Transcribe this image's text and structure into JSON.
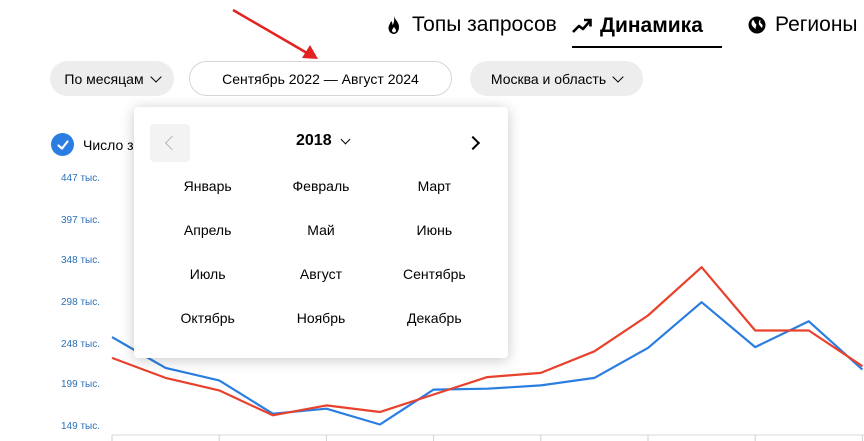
{
  "tabs": [
    {
      "label": "Топы запросов",
      "icon": "fire-icon",
      "active": false
    },
    {
      "label": "Динамика",
      "icon": "trend-up-icon",
      "active": true
    },
    {
      "label": "Регионы",
      "icon": "globe-icon",
      "active": false
    }
  ],
  "filters": {
    "period_mode": "По месяцам",
    "date_range": "Сентябрь 2022 — Август 2024",
    "region": "Москва и область"
  },
  "legend": {
    "series_label": "Число за"
  },
  "picker": {
    "year": "2018",
    "months": [
      "Январь",
      "Февраль",
      "Март",
      "Апрель",
      "Май",
      "Июнь",
      "Июль",
      "Август",
      "Сентябрь",
      "Октябрь",
      "Ноябрь",
      "Декабрь"
    ]
  },
  "colors": {
    "accent": "#2a7de1",
    "series_blue": "#2a7de1",
    "series_red": "#e8412c",
    "annotation_arrow": "#e32222"
  },
  "chart_data": {
    "type": "line",
    "y_tick_labels": [
      "447 тыс.",
      "397 тыс.",
      "348 тыс.",
      "298 тыс.",
      "248 тыс.",
      "199 тыс.",
      "149 тыс."
    ],
    "y_ticks": [
      447,
      397,
      348,
      298,
      248,
      199,
      149
    ],
    "ylim": [
      149,
      447
    ],
    "grid": false,
    "series": [
      {
        "color": "#2a7de1",
        "values": [
          257,
          220,
          205,
          165,
          171,
          152,
          194,
          195,
          199,
          208,
          244,
          299,
          245,
          276,
          218
        ]
      },
      {
        "color": "#e8412c",
        "values": [
          232,
          208,
          193,
          163,
          175,
          167,
          188,
          209,
          214,
          240,
          283,
          341,
          265,
          265,
          222
        ]
      }
    ]
  }
}
